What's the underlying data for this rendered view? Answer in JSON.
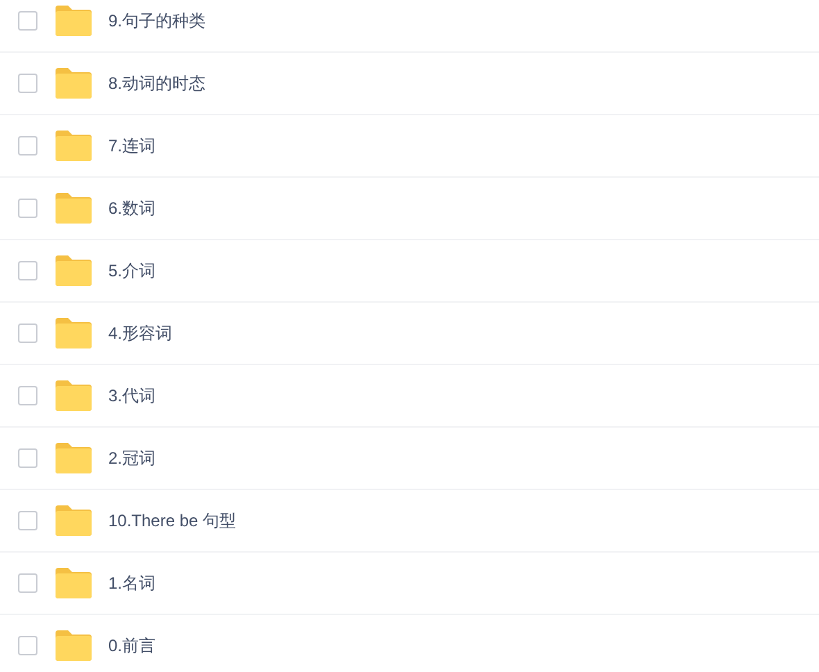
{
  "files": [
    {
      "name": "9.句子的种类",
      "checked": false
    },
    {
      "name": "8.动词的时态",
      "checked": false
    },
    {
      "name": "7.连词",
      "checked": false
    },
    {
      "name": "6.数词",
      "checked": false
    },
    {
      "name": "5.介词",
      "checked": false
    },
    {
      "name": "4.形容词",
      "checked": false
    },
    {
      "name": "3.代词",
      "checked": false
    },
    {
      "name": "2.冠词",
      "checked": false
    },
    {
      "name": "10.There be 句型",
      "checked": false
    },
    {
      "name": "1.名词",
      "checked": false
    },
    {
      "name": "0.前言",
      "checked": false
    }
  ]
}
